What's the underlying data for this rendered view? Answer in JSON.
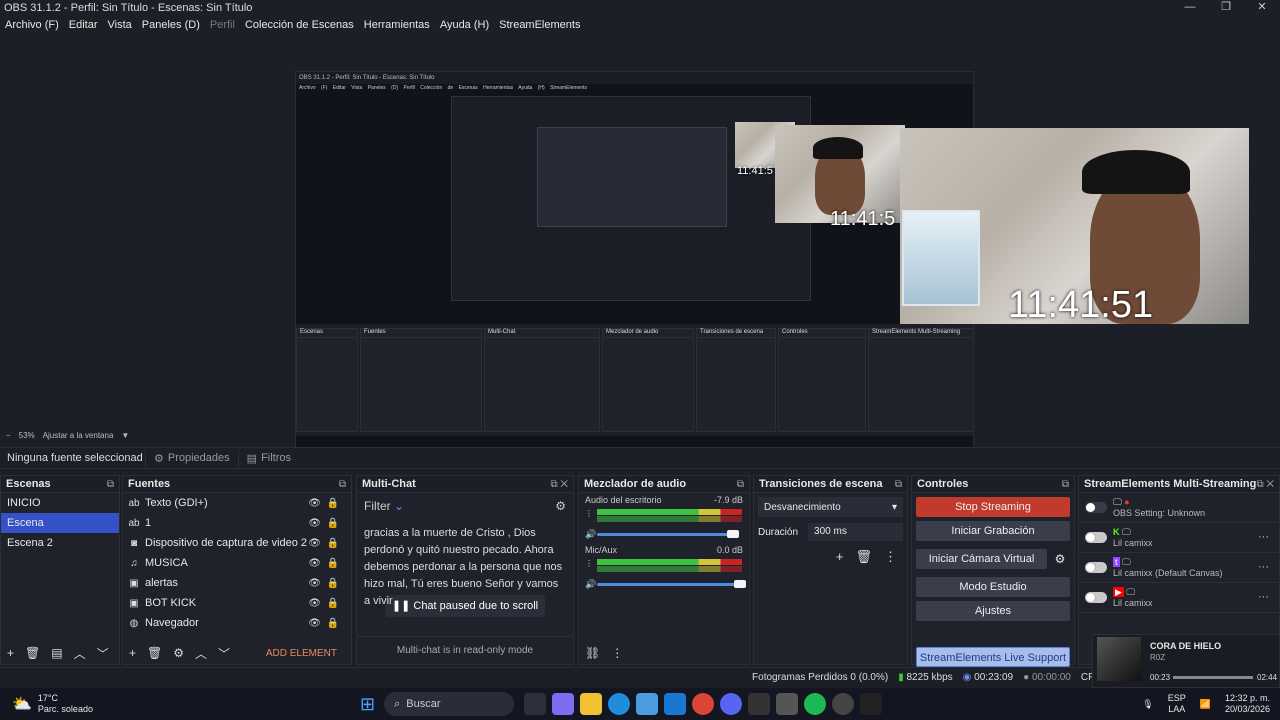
{
  "window": {
    "title": "OBS 31.1.2 - Perfil: Sin Título - Escenas: Sin Título",
    "controls": [
      "—",
      "❐",
      "✕"
    ]
  },
  "menu": [
    "Archivo (F)",
    "Editar",
    "Vista",
    "Paneles (D)",
    "Perfil",
    "Colección de Escenas",
    "Herramientas",
    "Ayuda (H)",
    "StreamElements"
  ],
  "preview": {
    "clock_large": "11:41:51",
    "clock_mid": "11:41:5",
    "clock_small": "11:41:5",
    "inner_title": "OBS 31.1.2 - Perfil: Sin Título - Escenas: Sin Título",
    "inner_menu": "Archivo (F) Editar Vista Paneles (D) Perfil Colección de Escenas Herramientas Ayuda (H) StreamElements"
  },
  "zoom": {
    "minus": "−",
    "value": "53%",
    "fit": "Ajustar a la ventana"
  },
  "propbar": {
    "no_source": "Ninguna fuente seleccionad",
    "properties": "Propiedades",
    "filters": "Filtros"
  },
  "scenes": {
    "title": "Escenas",
    "items": [
      "INICIO",
      "Escena",
      "Escena 2"
    ]
  },
  "sources": {
    "title": "Fuentes",
    "items": [
      {
        "icon": "ab",
        "label": "Texto (GDI+)"
      },
      {
        "icon": "ab",
        "label": "1"
      },
      {
        "icon": "◙",
        "label": "Dispositivo de captura de video 2"
      },
      {
        "icon": "♫",
        "label": "MUSICA"
      },
      {
        "icon": "▣",
        "label": "alertas"
      },
      {
        "icon": "▣",
        "label": "BOT KICK"
      },
      {
        "icon": "◍",
        "label": "Navegador"
      }
    ],
    "add_element": "ADD ELEMENT"
  },
  "multichat": {
    "title": "Multi-Chat",
    "filter": "Filter",
    "message": "gracias a la muerte de Cristo , Dios perdonó y quitó nuestro pecado. Ahora debemos perdonar a la persona que nos hizo mal, Tú eres bueno Señor y vamos a vivir",
    "paused": "Chat paused due to scroll",
    "readonly": "Multi-chat is in read-only mode"
  },
  "mixer": {
    "title": "Mezclador de audio",
    "tracks": [
      {
        "name": "Audio del escritorio",
        "db": "-7.9 dB",
        "level": 0.95
      },
      {
        "name": "Mic/Aux",
        "db": "0.0 dB",
        "level": 1.0
      }
    ],
    "scale": "-60 -55 -50 -45 -40 -35 -30 -25 -20 -15 -10 -5 0"
  },
  "transitions": {
    "title": "Transiciones de escena",
    "selected": "Desvanecimiento",
    "duration_label": "Duración",
    "duration_value": "300 ms"
  },
  "controls": {
    "title": "Controles",
    "stop_streaming": "Stop Streaming",
    "start_recording": "Iniciar Grabación",
    "virtual_cam": "Iniciar Cámara Virtual",
    "studio_mode": "Modo Estudio",
    "settings": "Ajustes",
    "se_support": "StreamElements Live Support"
  },
  "streamelements": {
    "title": "StreamElements Multi-Streaming",
    "rows": [
      {
        "label": "OBS Setting: Unknown",
        "platform": "obs"
      },
      {
        "label": "Lil camixx",
        "platform": "kick"
      },
      {
        "label": "Lil camixx (Default Canvas)",
        "platform": "twitch"
      },
      {
        "label": "Lil camixx",
        "platform": "youtube"
      }
    ],
    "colors": {
      "kick": "#53fc18",
      "twitch": "#9146ff",
      "youtube": "#ff0000"
    }
  },
  "status": {
    "dropped": "Fotogramas Perdidos 0 (0.0%)",
    "bitrate": "8225 kbps",
    "live_time": "00:23:09",
    "rec_time": "00:00:00",
    "cpu": "CPU"
  },
  "media": {
    "title": "CORA DE HIELO",
    "artist": "R0Z",
    "elapsed": "00:23",
    "total": "02:44"
  },
  "taskbar": {
    "weather_temp": "17°C",
    "weather_desc": "Parc. soleado",
    "search": "Buscar",
    "lang": "ESP",
    "lang2": "LAA",
    "time": "12:32 p. m.",
    "date": "20/03/2026"
  }
}
